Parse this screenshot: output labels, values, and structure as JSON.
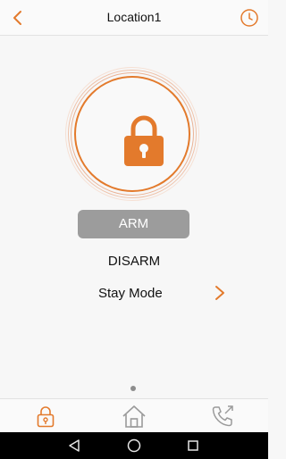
{
  "header": {
    "title": "Location1",
    "back_icon": "chevron-left-icon",
    "history_icon": "clock-icon"
  },
  "arm_control": {
    "lock_icon": "padlock-icon",
    "arm_label": "ARM",
    "disarm_label": "DISARM",
    "stay_mode_label": "Stay Mode",
    "stay_mode_icon": "chevron-right-icon"
  },
  "pager": {
    "current_page": 1,
    "total_pages": 1
  },
  "tabbar": {
    "tabs": [
      {
        "icon": "lock-tab-icon",
        "active": true
      },
      {
        "icon": "home-icon",
        "active": false
      },
      {
        "icon": "phone-call-icon",
        "active": false
      }
    ]
  },
  "system_nav": {
    "buttons": [
      "back-triangle-icon",
      "home-circle-icon",
      "recent-square-icon"
    ]
  },
  "colors": {
    "accent": "#e37a2c",
    "arm_button_bg": "#9c9c9c",
    "inactive_icon": "#9a9a9a",
    "background": "#f7f7f7",
    "system_bar": "#000000"
  }
}
